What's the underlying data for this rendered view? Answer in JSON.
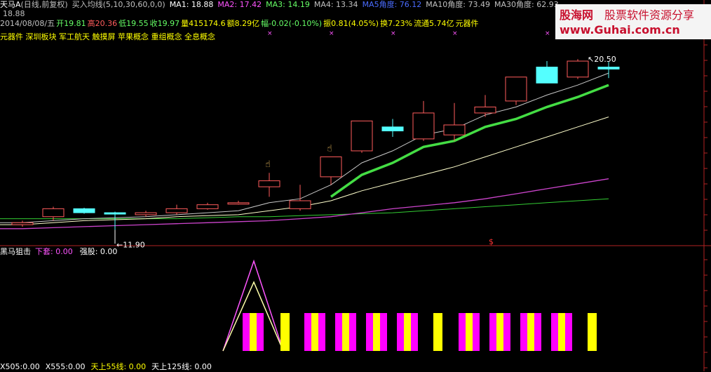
{
  "colors": {
    "bg": "#000000",
    "up": "#ff5c5c",
    "down": "#54ffff",
    "ma1": "#ffffff",
    "ma2": "#ff55ff",
    "ma3": "#66ff66",
    "ma4": "#c0c0c0",
    "ma5": "#4a6cff",
    "yellow": "#ffff00",
    "magenta": "#ff00ff",
    "axis": "#b22222"
  },
  "header": {
    "title": "天马A",
    "period": "(日线,前复权)",
    "indicator": "买入均线(5,10,30,60,0,0)",
    "ma1": "MA1: 18.88",
    "ma2": "MA2: 17.42",
    "ma3": "MA3: 14.19",
    "ma4": "MA4: 13.34",
    "ma5": "MA5角度: 76.12",
    "ma10": "MA10角度: 73.49",
    "ma30": "MA30角度: 62.93",
    "cut_value": "18.88"
  },
  "quote": {
    "date": "2014/08/08/五",
    "open": "开19.81",
    "high": "高20.36",
    "low": "低19.55",
    "close": "收19.97",
    "volume": "量415174.6",
    "amount": "额8.29亿",
    "change": "幅-0.02(-0.10%)",
    "amplitude": "振0.81(4.05%)",
    "turnover": "换7.23%",
    "float": "流通5.74亿",
    "sector": "元器件"
  },
  "concepts": "元器件 深圳板块 军工航天 触摸屏 苹果概念 重组概念 全息概念",
  "chart_data": {
    "type": "candlestick",
    "price_range": [
      11.5,
      21.0
    ],
    "high_label": "20.50",
    "low_label": "11.90",
    "candles": [
      {
        "o": 12.2,
        "c": 12.3,
        "h": 12.4,
        "l": 12.1
      },
      {
        "o": 12.6,
        "c": 13.0,
        "h": 13.1,
        "l": 12.4
      },
      {
        "o": 13.0,
        "c": 12.8,
        "h": 13.05,
        "l": 12.75
      },
      {
        "o": 12.8,
        "c": 12.75,
        "h": 12.85,
        "l": 11.95
      },
      {
        "o": 12.7,
        "c": 12.8,
        "h": 12.9,
        "l": 12.6
      },
      {
        "o": 12.8,
        "c": 13.0,
        "h": 13.2,
        "l": 12.7
      },
      {
        "o": 13.0,
        "c": 13.2,
        "h": 13.3,
        "l": 12.95
      },
      {
        "o": 13.3,
        "c": 13.3,
        "h": 13.4,
        "l": 13.2
      },
      {
        "o": 14.1,
        "c": 14.4,
        "h": 14.8,
        "l": 13.6
      },
      {
        "o": 13.0,
        "c": 13.4,
        "h": 14.2,
        "l": 12.9
      },
      {
        "o": 14.6,
        "c": 15.6,
        "h": 15.6,
        "l": 14.2
      },
      {
        "o": 15.9,
        "c": 17.4,
        "h": 17.4,
        "l": 15.8
      },
      {
        "o": 17.1,
        "c": 16.9,
        "h": 17.5,
        "l": 16.6
      },
      {
        "o": 16.5,
        "c": 17.8,
        "h": 18.4,
        "l": 16.4
      },
      {
        "o": 16.7,
        "c": 17.2,
        "h": 18.3,
        "l": 16.4
      },
      {
        "o": 17.8,
        "c": 18.1,
        "h": 18.7,
        "l": 17.6
      },
      {
        "o": 18.4,
        "c": 19.6,
        "h": 19.6,
        "l": 18.2
      },
      {
        "o": 20.1,
        "c": 19.3,
        "h": 20.4,
        "l": 19.3
      },
      {
        "o": 19.6,
        "c": 20.4,
        "h": 20.5,
        "l": 19.5
      },
      {
        "o": 20.1,
        "c": 20.0,
        "h": 20.36,
        "l": 19.55
      }
    ],
    "ma5": [
      12.3,
      12.4,
      12.5,
      12.55,
      12.6,
      12.7,
      12.8,
      12.9,
      13.3,
      13.5,
      14.2,
      15.3,
      15.9,
      16.7,
      17.0,
      17.7,
      18.1,
      18.7,
      19.2,
      19.8
    ],
    "ma10": [
      12.2,
      12.3,
      12.4,
      12.45,
      12.5,
      12.6,
      12.65,
      12.7,
      12.9,
      13.1,
      13.4,
      13.9,
      14.3,
      14.7,
      15.1,
      15.6,
      16.1,
      16.6,
      17.1,
      17.6
    ],
    "ma30": [
      12.0,
      12.05,
      12.1,
      12.15,
      12.2,
      12.25,
      12.3,
      12.35,
      12.4,
      12.5,
      12.6,
      12.8,
      13.0,
      13.15,
      13.3,
      13.5,
      13.75,
      14.0,
      14.25,
      14.5
    ],
    "ma60": [
      12.5,
      12.5,
      12.5,
      12.5,
      12.5,
      12.5,
      12.55,
      12.6,
      12.6,
      12.65,
      12.7,
      12.75,
      12.8,
      12.9,
      13.0,
      13.1,
      13.2,
      13.3,
      13.4,
      13.5
    ]
  },
  "sub": {
    "title": "黑马狙击",
    "label1": "下套: 0.00",
    "label2": "强股: 0.00",
    "footer1": "X505:0.00",
    "footer2": "X555:0.00",
    "footer3": "天上55线: 0.00",
    "footer4": "天上125线: 0.00"
  },
  "watermark": {
    "site": "股海网",
    "slogan": "股票软件资源分享",
    "url": "www.Guhai.com.cn"
  }
}
